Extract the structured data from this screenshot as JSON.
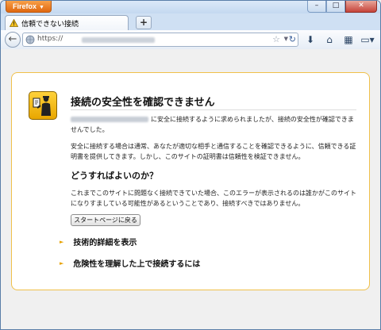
{
  "window": {
    "app_menu_label": "Firefox",
    "controls": {
      "minimize": "–",
      "maximize": "□",
      "close": "✕"
    }
  },
  "tabs": [
    {
      "label": "信頼できない接続",
      "icon": "warning-icon"
    }
  ],
  "new_tab_label": "+",
  "navbar": {
    "url_prefix": "https://",
    "icons": [
      "back-arrow-icon",
      "globe-icon",
      "bookmark-star-icon",
      "dropdown-arrow-icon",
      "reload-icon",
      "downloads-icon",
      "home-icon",
      "bookmarks-menu-icon",
      "toolbar-menu-icon"
    ]
  },
  "error_page": {
    "title": "接続の安全性を確認できません",
    "paragraph1": "に安全に接続するように求められましたが、接続の安全性が確認できませんでした。",
    "paragraph2": "安全に接続する場合は通常、あなたが適切な相手と通信することを確認できるように、信頼できる証明書を提供してきます。しかし、このサイトの証明書は信頼性を検証できません。",
    "heading2": "どうすればよいのか？",
    "paragraph3": "これまでこのサイトに問題なく接続できていた場合、このエラーが表示されるのは誰かがこのサイトになりすましている可能性があるということであり、接続すべきではありません。",
    "button_label": "スタートページに戻る",
    "expanders": [
      {
        "label": "技術的詳細を表示"
      },
      {
        "label": "危険性を理解した上で接続するには"
      }
    ],
    "accent_color": "#f0c04a",
    "badge_color": "#f5b800",
    "icon": "security-officer-icon"
  }
}
